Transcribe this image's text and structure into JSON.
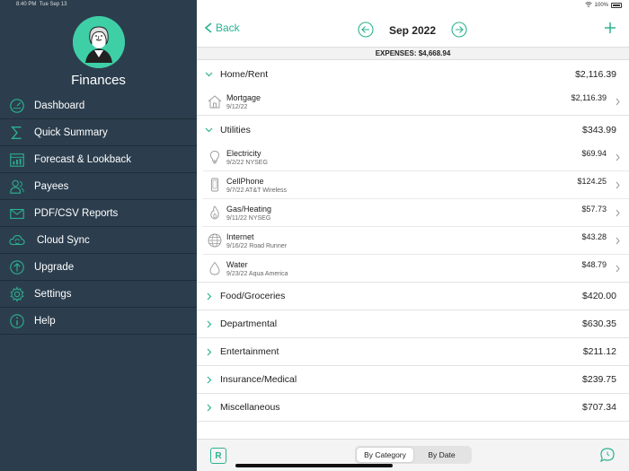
{
  "status": {
    "time": "8:40 PM",
    "date": "Tue Sep 13",
    "battery": "100%"
  },
  "sidebar": {
    "app_name": "Finances",
    "items": [
      {
        "label": "Dashboard",
        "icon": "gauge-icon"
      },
      {
        "label": "Quick Summary",
        "icon": "sigma-icon"
      },
      {
        "label": "Forecast & Lookback",
        "icon": "calendar-chart-icon"
      },
      {
        "label": "Payees",
        "icon": "people-icon"
      },
      {
        "label": "PDF/CSV Reports",
        "icon": "envelope-icon"
      },
      {
        "label": "Cloud Sync",
        "icon": "cloud-sync-icon"
      },
      {
        "label": "Upgrade",
        "icon": "arrow-up-circle-icon"
      },
      {
        "label": "Settings",
        "icon": "gear-icon"
      },
      {
        "label": "Help",
        "icon": "info-icon"
      }
    ]
  },
  "header": {
    "back_label": "Back",
    "month": "Sep 2022"
  },
  "expenses_label": "EXPENSES: $4,668.94",
  "categories": {
    "home": {
      "name": "Home/Rent",
      "amount": "$2,116.39"
    },
    "utilities": {
      "name": "Utilities",
      "amount": "$343.99"
    },
    "food": {
      "name": "Food/Groceries",
      "amount": "$420.00"
    },
    "departmental": {
      "name": "Departmental",
      "amount": "$630.35"
    },
    "entertainment": {
      "name": "Entertainment",
      "amount": "$211.12"
    },
    "insurance": {
      "name": "Insurance/Medical",
      "amount": "$239.75"
    },
    "misc": {
      "name": "Miscellaneous",
      "amount": "$707.34"
    }
  },
  "items": {
    "mortgage": {
      "name": "Mortgage",
      "detail": "9/12/22",
      "amount": "$2,116.39"
    },
    "electricity": {
      "name": "Electricity",
      "detail": "9/2/22 NYSEG",
      "amount": "$69.94"
    },
    "cellphone": {
      "name": "CellPhone",
      "detail": "9/7/22 AT&T Wireless",
      "amount": "$124.25"
    },
    "gas": {
      "name": "Gas/Heating",
      "detail": "9/11/22 NYSEG",
      "amount": "$57.73"
    },
    "internet": {
      "name": "Internet",
      "detail": "9/16/22 Road Runner",
      "amount": "$43.28"
    },
    "water": {
      "name": "Water",
      "detail": "9/23/22 Aqua America",
      "amount": "$48.79"
    }
  },
  "bottom": {
    "r_label": "R",
    "seg_category": "By Category",
    "seg_date": "By Date"
  },
  "colors": {
    "accent": "#2bb38f",
    "sidebar": "#2c3e4e",
    "avatar_bg": "#3ecfa6"
  }
}
